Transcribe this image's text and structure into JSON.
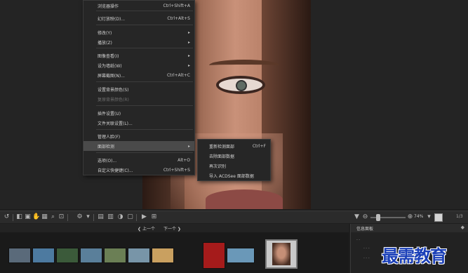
{
  "context_menu": {
    "items": [
      {
        "label": "浏览器操作",
        "shortcut": "Ctrl+Shift+A",
        "arrow": ""
      },
      {
        "label": "幻灯放映(D)...",
        "shortcut": "Ctrl+Alt+S",
        "arrow": ""
      },
      {
        "label": "修改(Y)",
        "shortcut": "",
        "arrow": "▸"
      },
      {
        "label": "播放(Z)",
        "shortcut": "",
        "arrow": "▸"
      },
      {
        "label": "图像查看(I)",
        "shortcut": "",
        "arrow": "▸"
      },
      {
        "label": "设为墙纸(W)",
        "shortcut": "",
        "arrow": "▸"
      },
      {
        "label": "屏幕截图(N)...",
        "shortcut": "Ctrl+Alt+C",
        "arrow": ""
      },
      {
        "label": "设置背景颜色(S)",
        "shortcut": "",
        "arrow": ""
      },
      {
        "label": "复原背景颜色(R)",
        "shortcut": "",
        "arrow": ""
      },
      {
        "label": "插件设置(U)",
        "shortcut": "",
        "arrow": ""
      },
      {
        "label": "文件关联设置(L)...",
        "shortcut": "",
        "arrow": ""
      },
      {
        "label": "管理人脸(F)",
        "shortcut": "",
        "arrow": ""
      },
      {
        "label": "面部检测",
        "shortcut": "",
        "arrow": "▸"
      },
      {
        "label": "选项(O)...",
        "shortcut": "Alt+O",
        "arrow": ""
      },
      {
        "label": "自定义快捷键(C)...",
        "shortcut": "Ctrl+Shift+S",
        "arrow": ""
      }
    ]
  },
  "submenu": {
    "items": [
      {
        "label": "重新检测面部",
        "shortcut": "Ctrl+F"
      },
      {
        "label": "去除面部数据",
        "shortcut": ""
      },
      {
        "label": "再次识别",
        "shortcut": ""
      },
      {
        "label": "导入 ACDSee 面部数据",
        "shortcut": ""
      }
    ]
  },
  "toolbar": {
    "zoom_value": "74%",
    "page_count": "1/3",
    "icons": [
      "back-icon",
      "rotate-left-icon",
      "rotate-right-icon",
      "hand-icon",
      "select-icon",
      "zoom-icon",
      "crop-icon",
      "settings-icon",
      "grid-icon",
      "compare-icon",
      "info-icon",
      "play-icon",
      "fullscreen-icon"
    ]
  },
  "filmstrip": {
    "prev_label": "上一个",
    "next_label": "下一个",
    "thumbnails": [
      {
        "name": "thumb-landscape-1",
        "color": "#5a6a7a"
      },
      {
        "name": "thumb-landscape-2",
        "color": "#4d7aa0"
      },
      {
        "name": "thumb-forest",
        "color": "#3b5a3a"
      },
      {
        "name": "thumb-lake",
        "color": "#5a7f9a"
      },
      {
        "name": "thumb-valley",
        "color": "#6b7f55"
      },
      {
        "name": "thumb-coast",
        "color": "#7895a8"
      },
      {
        "name": "thumb-beach",
        "color": "#c9a060"
      },
      {
        "name": "thumb-2020-poster",
        "color": "#a51b1b"
      },
      {
        "name": "thumb-sky",
        "color": "#6a98b8"
      },
      {
        "name": "thumb-portrait",
        "color": "#c9c9c9"
      }
    ]
  },
  "info_panel": {
    "title": "信息面板",
    "pin": "◆"
  },
  "watermark": "最需教育"
}
